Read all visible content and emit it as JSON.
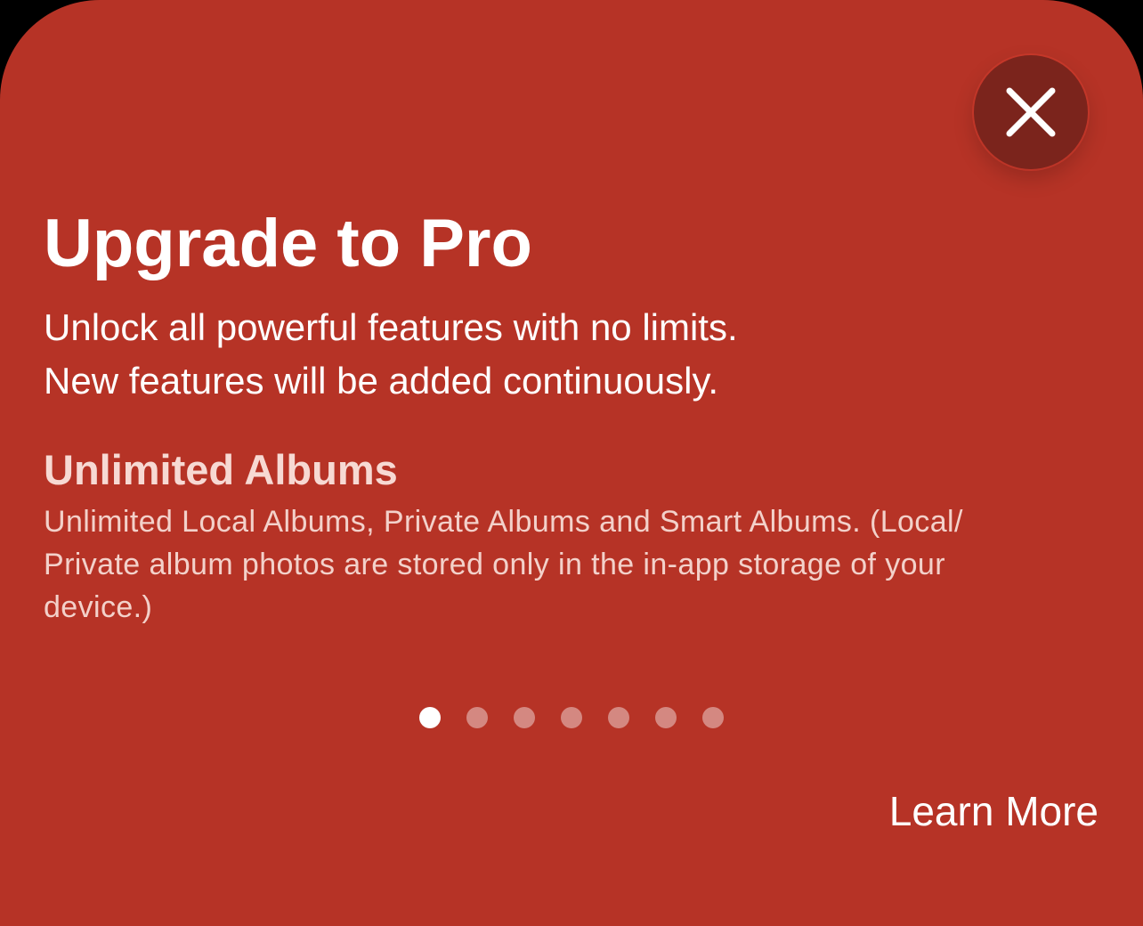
{
  "colors": {
    "sheet_background": "#b63326",
    "close_button_background": "#7b241c",
    "text_primary": "#ffffff",
    "feature_title": "#f7d9d3",
    "feature_description": "#f3d1ca"
  },
  "close_button": {
    "icon": "close-icon"
  },
  "header": {
    "title": "Upgrade to Pro",
    "subtitle_lines": [
      "Unlock all powerful features with no limits.",
      "New features will be added continuously."
    ]
  },
  "feature": {
    "title": "Unlimited Albums",
    "description_lines": [
      "Unlimited Local Albums, Private Albums and Smart Albums. (Local/",
      "Private album photos are stored only in the in-app storage of your",
      "device.)"
    ]
  },
  "pager": {
    "page_count": 7,
    "current_page": 1
  },
  "footer": {
    "learn_more_label": "Learn More"
  }
}
